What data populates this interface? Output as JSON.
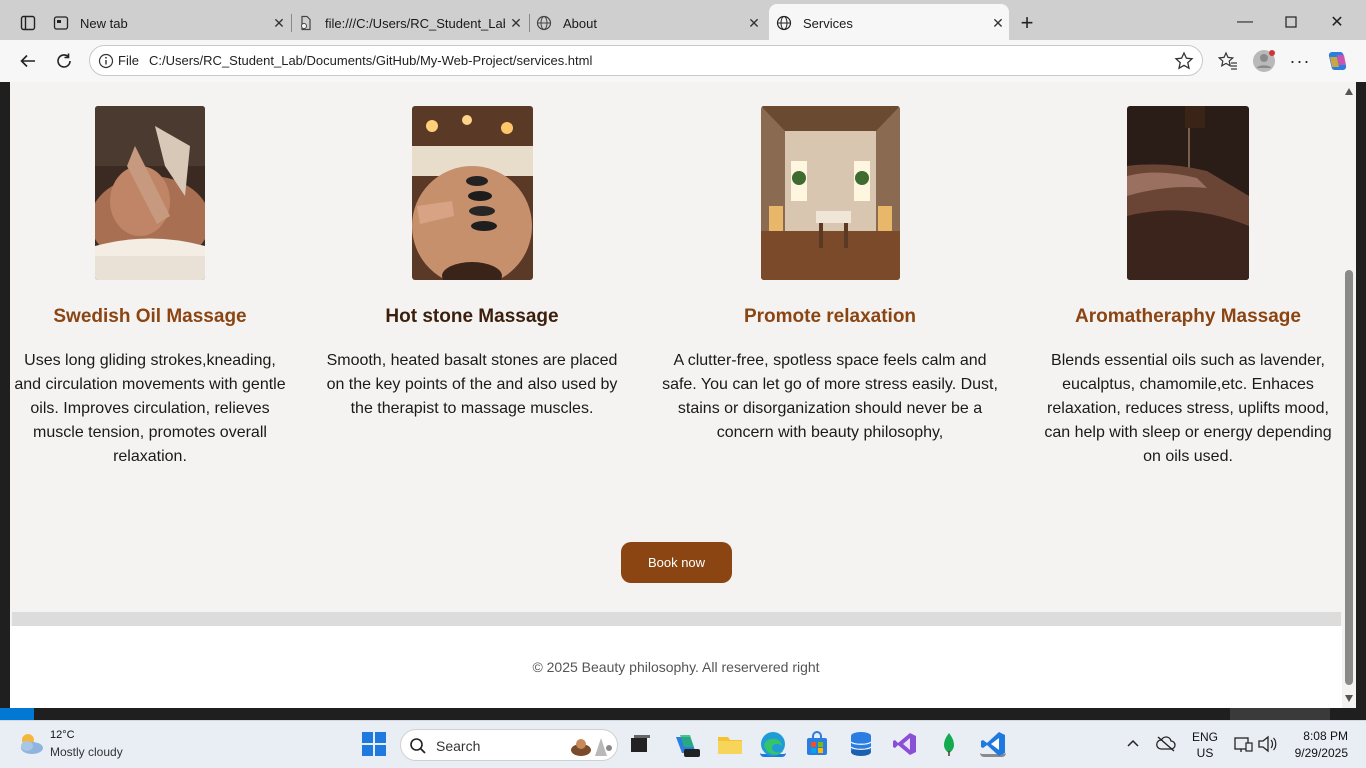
{
  "browser": {
    "tabs": [
      {
        "title": "New tab"
      },
      {
        "title": "file:///C:/Users/RC_Student_Lab/D"
      },
      {
        "title": "About"
      },
      {
        "title": "Services"
      }
    ],
    "address": {
      "scheme": "File",
      "url": "C:/Users/RC_Student_Lab/Documents/GitHub/My-Web-Project/services.html"
    }
  },
  "page": {
    "services": [
      {
        "title": "Swedish Oil Massage",
        "text": "Uses long gliding strokes,kneading, and circulation movements with gentle oils. Improves circulation, relieves muscle tension, promotes overall relaxation.",
        "image": "back-massage-photo"
      },
      {
        "title": "Hot stone Massage",
        "text": "Smooth, heated basalt stones are placed on the key points of the and also used by the therapist to massage muscles.",
        "image": "hot-stones-photo"
      },
      {
        "title": "Promote relaxation",
        "text": "A clutter-free, spotless space feels calm and safe. You can let go of more stress easily. Dust, stains or disorganization should never be a concern with beauty philosophy,",
        "image": "spa-room-photo"
      },
      {
        "title": "Aromatheraphy Massage",
        "text": "Blends essential oils such as lavender, eucalptus, chamomile,etc. Enhaces relaxation, reduces stress, uplifts mood, can help with sleep or energy depending on oils used.",
        "image": "essential-oil-photo"
      }
    ],
    "book_button": "Book now",
    "footer": "© 2025 Beauty philosophy. All reservered right",
    "colors": {
      "accent": "#8b4513",
      "heading_dark": "#3b1f0c",
      "background": "#f4f3f2"
    }
  },
  "taskbar": {
    "weather_temp": "12°C",
    "weather_desc": "Mostly cloudy",
    "search_label": "Search",
    "lang_top": "ENG",
    "lang_bottom": "US",
    "time": "8:08 PM",
    "date": "9/29/2025"
  }
}
